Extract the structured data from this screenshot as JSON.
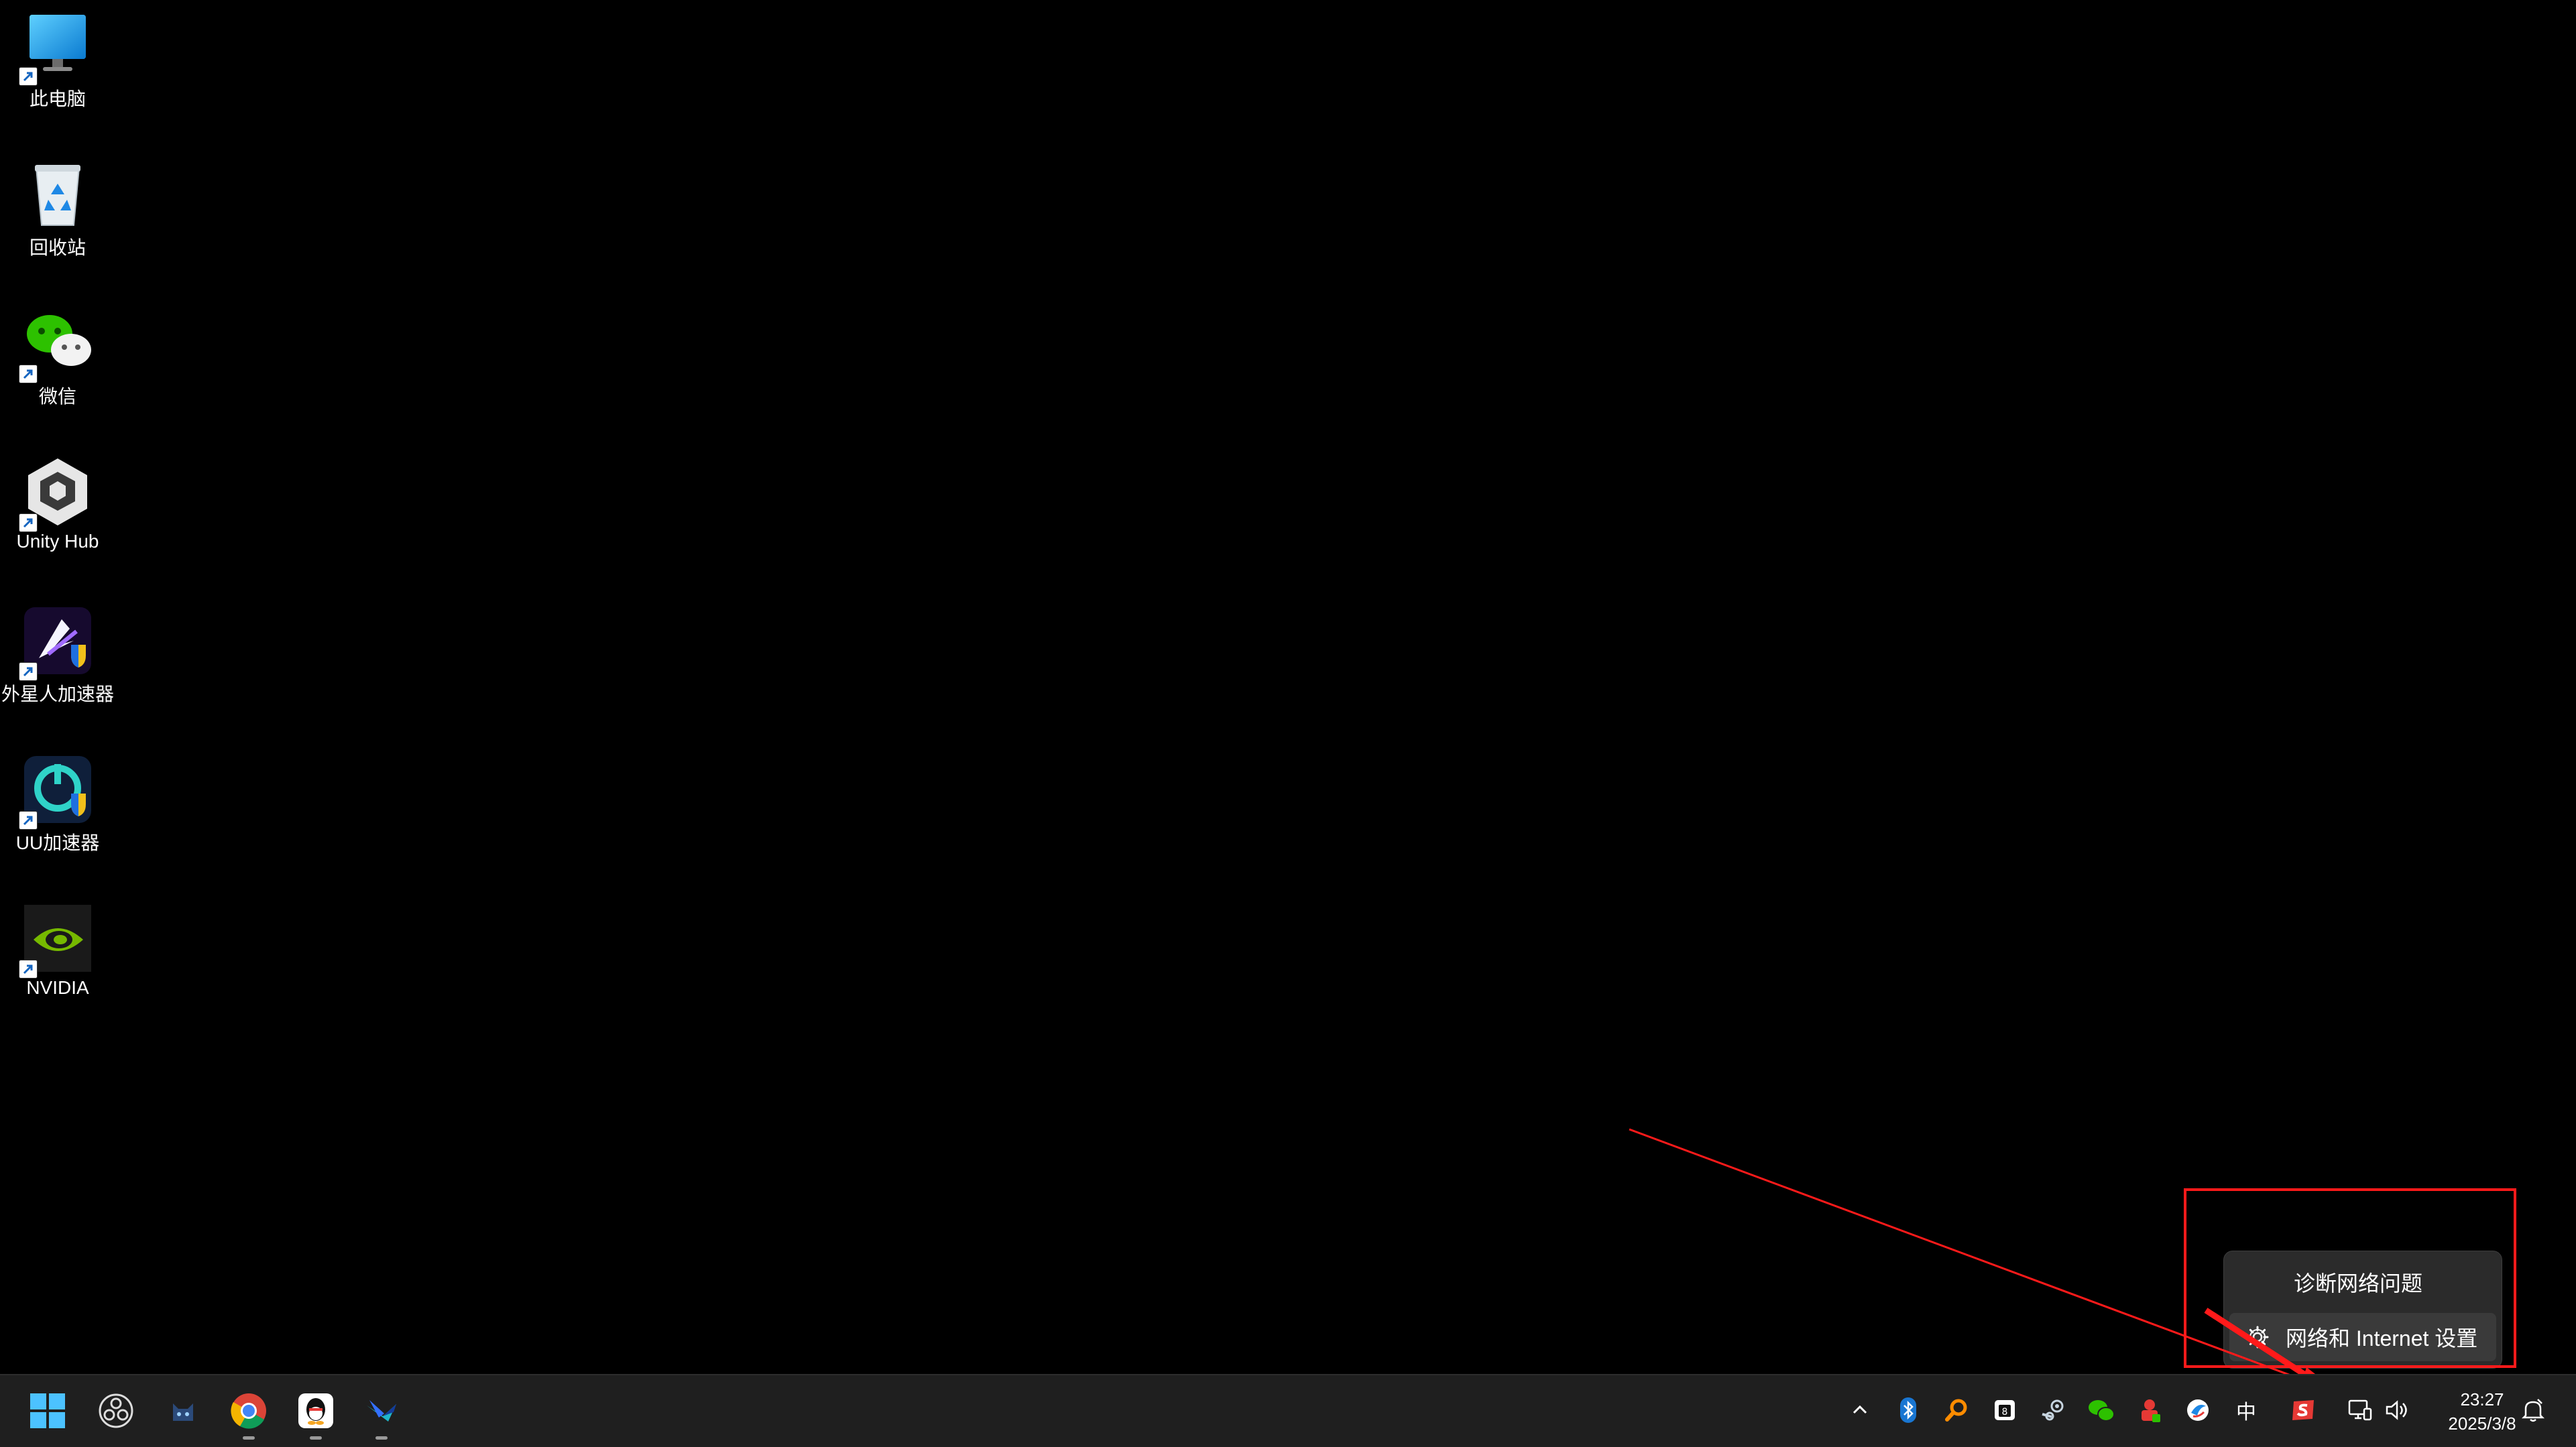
{
  "desktop": {
    "icons": [
      {
        "label": "此电脑",
        "icon": "monitor-icon"
      },
      {
        "label": "回收站",
        "icon": "recycle-bin-icon"
      },
      {
        "label": "微信",
        "icon": "wechat-icon"
      },
      {
        "label": "Unity Hub",
        "icon": "unity-hub-icon"
      },
      {
        "label": "外星人加速器",
        "icon": "alien-accelerator-icon"
      },
      {
        "label": "UU加速器",
        "icon": "uu-accelerator-icon"
      },
      {
        "label": "NVIDIA",
        "icon": "nvidia-icon"
      }
    ]
  },
  "context_menu": {
    "items": [
      {
        "label": "诊断网络问题"
      },
      {
        "label": "网络和 Internet 设置",
        "icon": "gear-icon"
      }
    ]
  },
  "taskbar": {
    "apps": [
      "start-icon",
      "obs-icon",
      "cat-app-icon",
      "chrome-icon",
      "qq-icon",
      "feishu-icon"
    ],
    "tray": [
      "chevron-up-icon",
      "bluetooth-icon",
      "search-tool-icon",
      "calendar-app-icon",
      "steam-icon",
      "wechat-tray-icon",
      "red-app-icon",
      "browser-tray-icon"
    ],
    "ime": "中",
    "clock": {
      "time": "23:27",
      "date": "2025/3/8"
    }
  },
  "colors": {
    "highlight_red": "#ff1a1a",
    "taskbar_bg": "#1f1f1f",
    "menu_bg": "#2b2b2b"
  }
}
